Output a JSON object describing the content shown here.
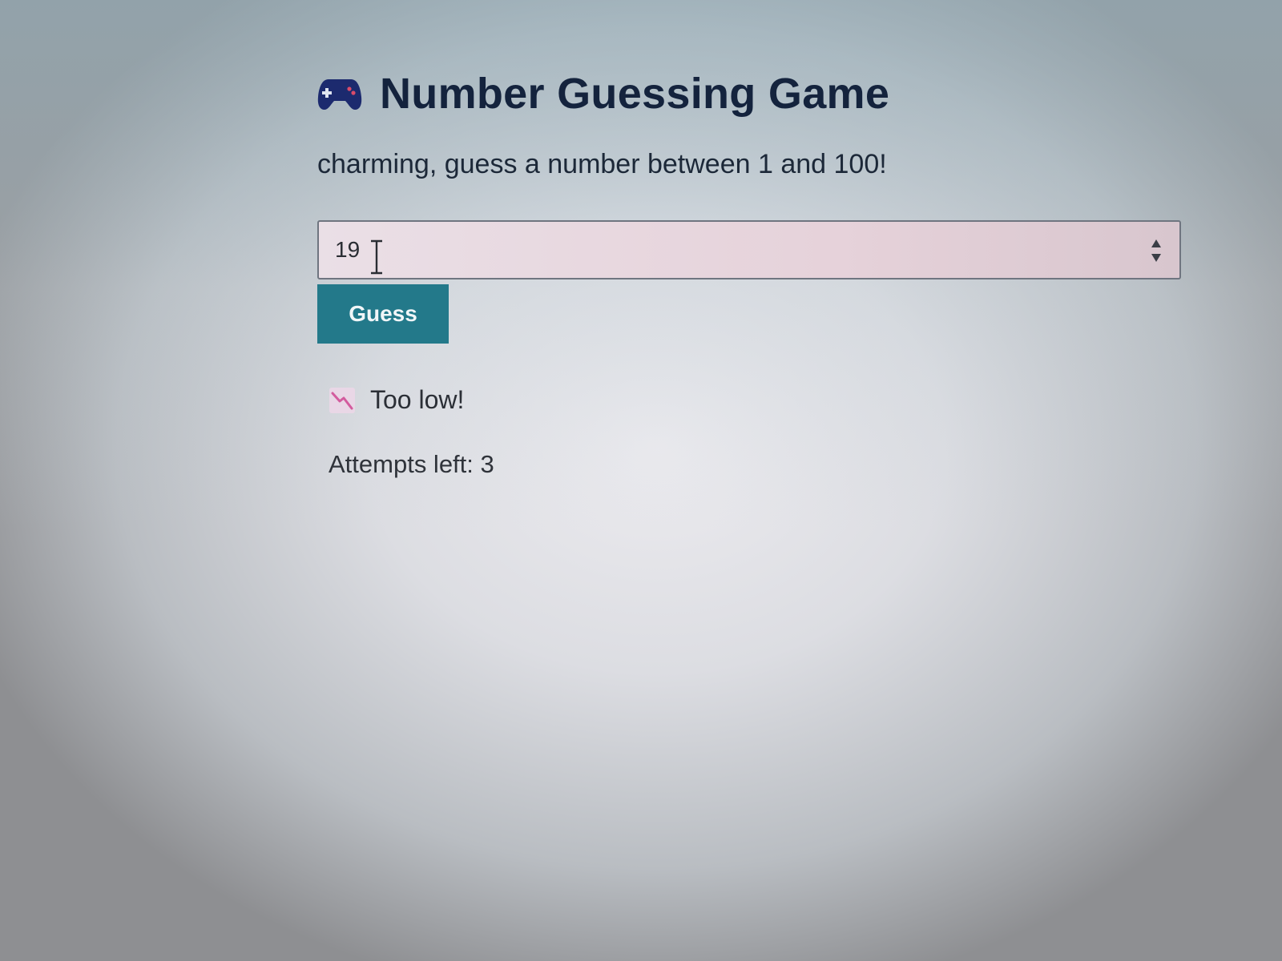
{
  "game": {
    "icon": "gamepad-icon",
    "title": "Number Guessing Game",
    "prompt": "charming, guess a number between 1 and 100!",
    "input": {
      "value": "19",
      "type": "number"
    },
    "guess_button_label": "Guess",
    "feedback": {
      "icon": "chart-decreasing-icon",
      "text": "Too low!"
    },
    "attempts_text": "Attempts left: 3"
  },
  "colors": {
    "title": "#14233d",
    "button": "#23798a",
    "icon_gamepad": "#1c2a6e",
    "icon_trend": "#d35c9e"
  }
}
